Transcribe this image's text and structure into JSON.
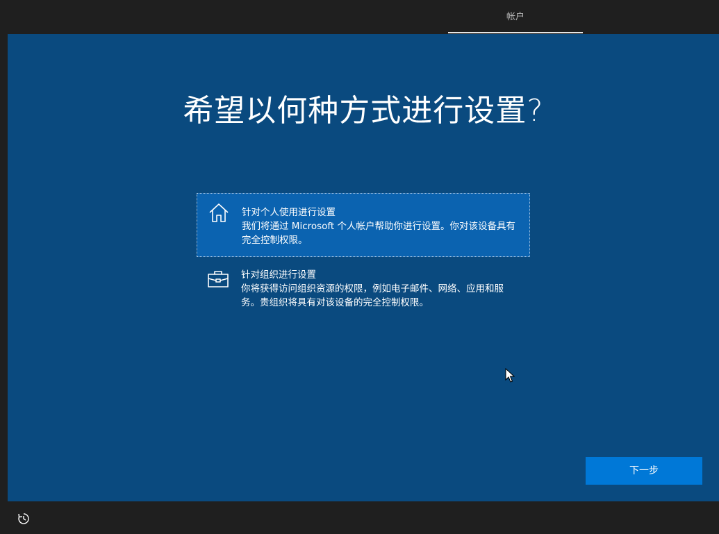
{
  "header": {
    "tab_label": "帐户"
  },
  "main": {
    "title": "希望以何种方式进行设置?",
    "options": [
      {
        "title": "针对个人使用进行设置",
        "description": "我们将通过 Microsoft 个人帐户帮助你进行设置。你对该设备具有完全控制权限。",
        "icon": "home-icon",
        "selected": true
      },
      {
        "title": "针对组织进行设置",
        "description": "你将获得访问组织资源的权限，例如电子邮件、网络、应用和服务。贵组织将具有对该设备的完全控制权限。",
        "icon": "briefcase-icon",
        "selected": false
      }
    ],
    "next_label": "下一步"
  },
  "footer": {
    "accessibility_icon": "ease-of-access-icon"
  },
  "colors": {
    "background": "#0a4a7f",
    "selected_option": "#0b63b0",
    "button": "#0078d7",
    "chrome": "#1f1f1f"
  }
}
